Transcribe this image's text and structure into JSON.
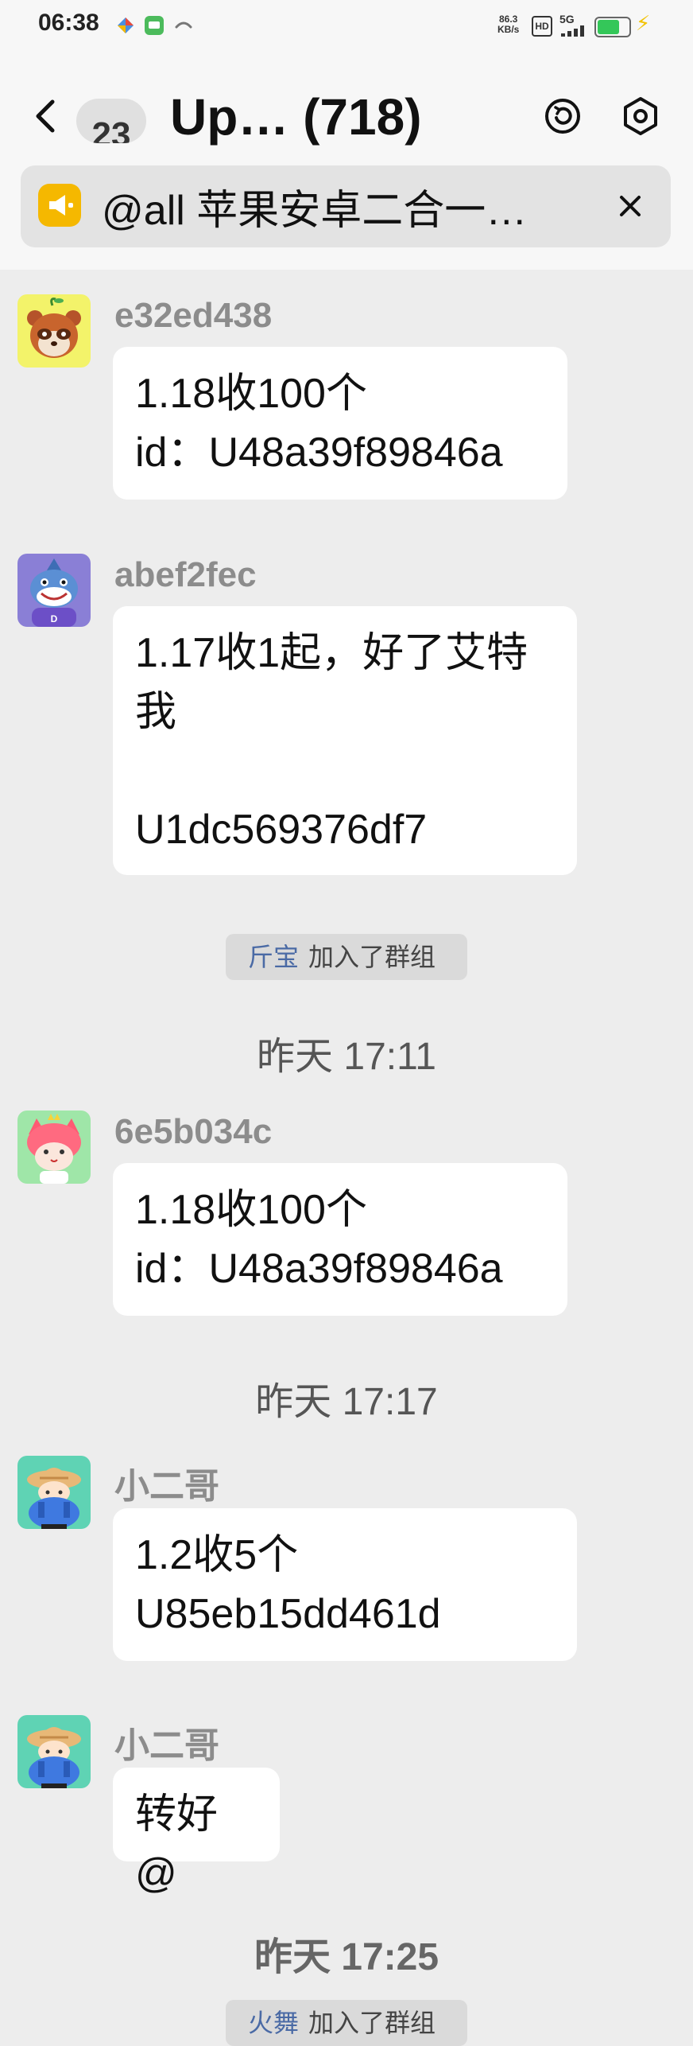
{
  "status_bar": {
    "time": "06:38",
    "net_speed_value": "86.3",
    "net_speed_unit": "KB/s",
    "hd_label": "HD",
    "network_label": "5G",
    "battery_level_percent": 70,
    "icons": [
      "app-icon-colorful",
      "message-icon",
      "link-icon",
      "signal-icon",
      "battery-icon",
      "charging-bolt-icon"
    ]
  },
  "header": {
    "back_icon": "chevron-left-icon",
    "unread_count": "23",
    "title": "Up… (718)",
    "actions": [
      "refresh-circle-icon",
      "settings-hexagon-icon"
    ]
  },
  "announcement": {
    "icon": "megaphone-icon",
    "text": "@all 苹果安卓二合一…",
    "close_icon": "close-icon",
    "accent_color": "#f5b800"
  },
  "messages": [
    {
      "sender": "e32ed438",
      "avatar": "raccoon-avatar",
      "text": "1.18收100个\nid：U48a39f89846a"
    },
    {
      "sender": "abef2fec",
      "avatar": "shark-avatar",
      "text": "1.17收1起，好了艾特\n我\n\nU1dc569376df7"
    },
    {
      "sender": "6e5b034c",
      "avatar": "pink-cat-avatar",
      "text": "1.18收100个\nid：U48a39f89846a"
    },
    {
      "sender": "小二哥",
      "avatar": "farmer-avatar",
      "text": "1.2收5个\nU85eb15dd461d"
    },
    {
      "sender": "小二哥",
      "avatar": "farmer-avatar",
      "text": "转好@"
    }
  ],
  "system_events": [
    {
      "name": "斤宝",
      "text": "加入了群组"
    },
    {
      "name": "火舞",
      "text": "加入了群组"
    }
  ],
  "timestamps": [
    "昨天 17:11",
    "昨天 17:17",
    "昨天 17:25"
  ],
  "colors": {
    "background": "#ededed",
    "bubble": "#ffffff",
    "system_name": "#4a6aa5"
  }
}
